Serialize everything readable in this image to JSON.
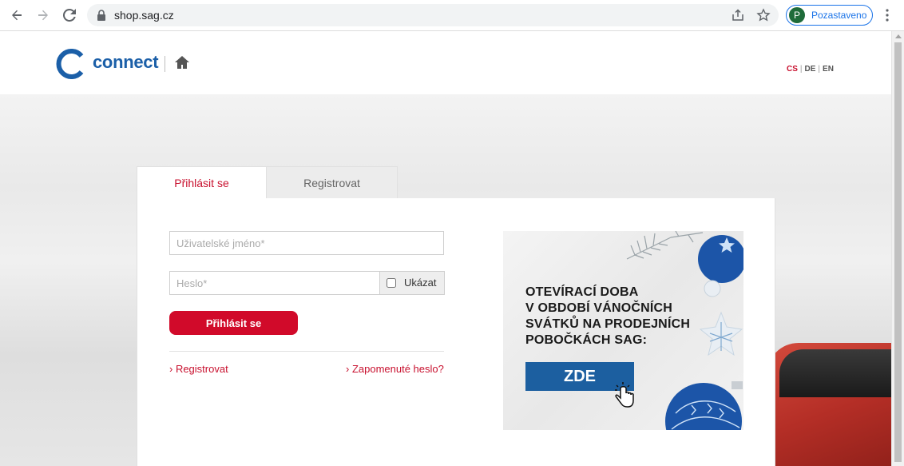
{
  "browser": {
    "url": "shop.sag.cz",
    "profile_initial": "P",
    "profile_label": "Pozastaveno"
  },
  "header": {
    "logo_text": "connect",
    "languages": [
      {
        "code": "CS",
        "active": true
      },
      {
        "code": "DE",
        "active": false
      },
      {
        "code": "EN",
        "active": false
      }
    ]
  },
  "tabs": {
    "login": "Přihlásit se",
    "register": "Registrovat"
  },
  "form": {
    "username_placeholder": "Uživatelské jméno*",
    "password_placeholder": "Heslo*",
    "show_label": "Ukázat",
    "submit_label": "Přihlásit se",
    "register_link": "› Registrovat",
    "forgot_link": "› Zapomenuté heslo?"
  },
  "banner": {
    "lines": [
      "OTEVÍRACÍ DOBA",
      "V OBDOBÍ VÁNOČNÍCH",
      "SVÁTKŮ NA PRODEJNÍCH",
      "POBOČKÁCH SAG:"
    ],
    "button_label": "ZDE"
  },
  "colors": {
    "brand_blue": "#1b5fa8",
    "accent_red": "#c8102e",
    "button_red": "#d10a2a",
    "banner_button": "#1c5fa0"
  }
}
